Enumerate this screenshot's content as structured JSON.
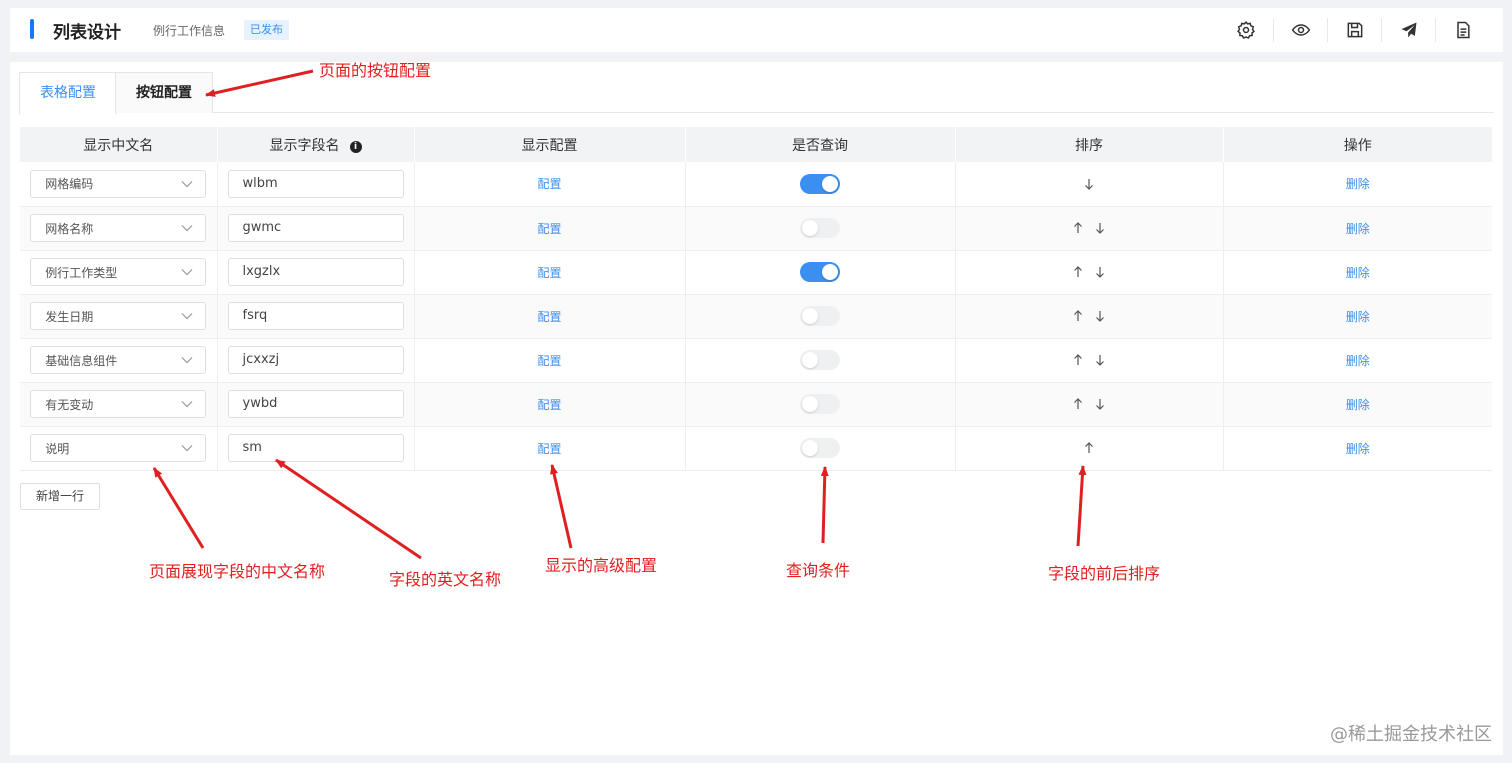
{
  "header": {
    "title": "列表设计",
    "subtitle": "例行工作信息",
    "badge": "已发布",
    "tools": [
      {
        "icon": "gear-icon"
      },
      {
        "icon": "eye-icon"
      },
      {
        "icon": "save-icon"
      },
      {
        "icon": "send-icon"
      },
      {
        "icon": "document-icon"
      }
    ]
  },
  "tabs": [
    {
      "label": "表格配置",
      "active": true
    },
    {
      "label": "按钮配置",
      "active": false
    }
  ],
  "table": {
    "headers": [
      "显示中文名",
      "显示字段名",
      "显示配置",
      "是否查询",
      "排序",
      "操作"
    ],
    "config_label": "配置",
    "delete_label": "删除",
    "rows": [
      {
        "cn_name": "网格编码",
        "field": "wlbm",
        "query": true,
        "up": false,
        "down": true
      },
      {
        "cn_name": "网格名称",
        "field": "gwmc",
        "query": false,
        "up": true,
        "down": true
      },
      {
        "cn_name": "例行工作类型",
        "field": "lxgzlx",
        "query": true,
        "up": true,
        "down": true
      },
      {
        "cn_name": "发生日期",
        "field": "fsrq",
        "query": false,
        "up": true,
        "down": true
      },
      {
        "cn_name": "基础信息组件",
        "field": "jcxxzj",
        "query": false,
        "up": true,
        "down": true
      },
      {
        "cn_name": "有无变动",
        "field": "ywbd",
        "query": false,
        "up": true,
        "down": true
      },
      {
        "cn_name": "说明",
        "field": "sm",
        "query": false,
        "up": true,
        "down": false
      }
    ]
  },
  "add_row_label": "新增一行",
  "annotations": {
    "button_config": "页面的按钮配置",
    "cn_name": "页面展现字段的中文名称",
    "en_name": "字段的英文名称",
    "advanced": "显示的高级配置",
    "query": "查询条件",
    "order": "字段的前后排序"
  },
  "watermark": "@稀土掘金技术社区",
  "colors": {
    "accent": "#1677ff",
    "link": "#3b8ff0",
    "annotation": "#e02020"
  }
}
